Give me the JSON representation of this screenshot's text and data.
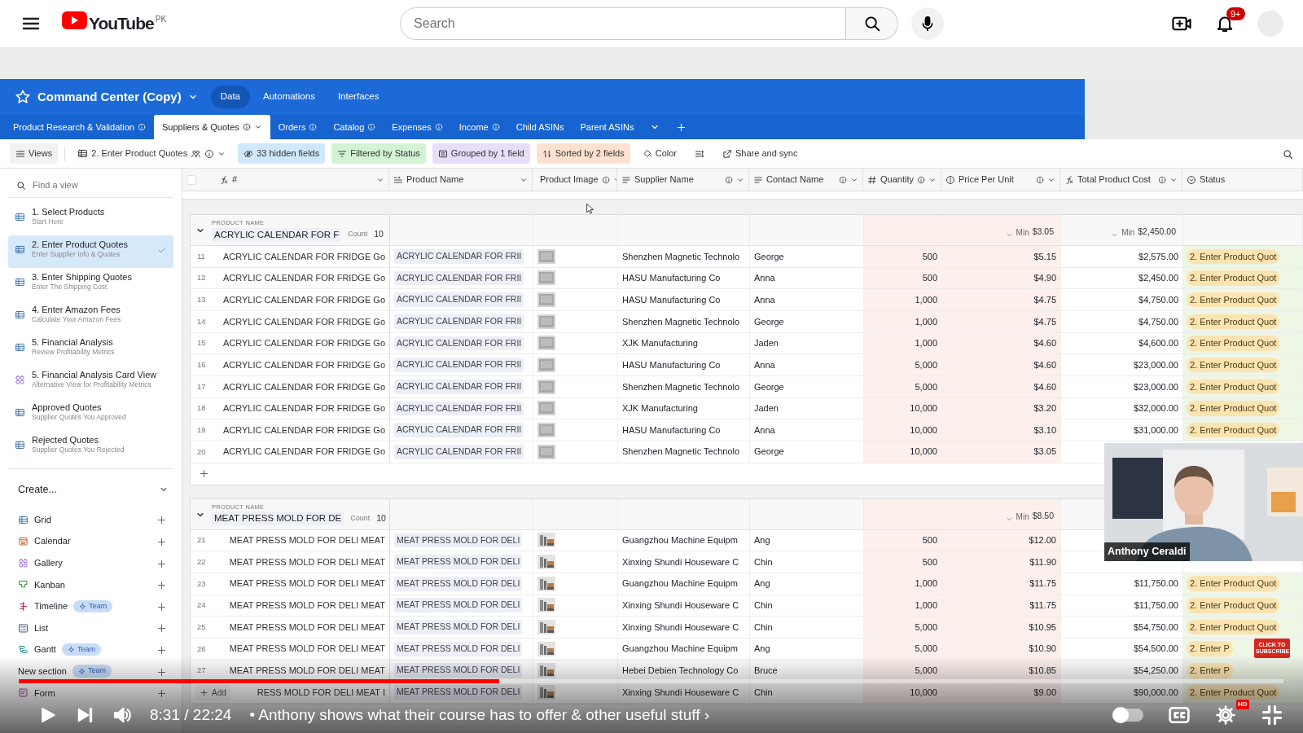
{
  "youtube": {
    "logo_text": "YouTube",
    "region": "PK",
    "search": {
      "placeholder": "Search"
    },
    "notifications": "9+"
  },
  "base": {
    "title": "Command Center (Copy)",
    "nav": [
      {
        "label": "Data",
        "selected": true
      },
      {
        "label": "Automations",
        "selected": false
      },
      {
        "label": "Interfaces",
        "selected": false
      }
    ]
  },
  "tables": [
    {
      "label": "Product Research & Validation",
      "selected": false,
      "info": true
    },
    {
      "label": "Suppliers & Quotes",
      "selected": true,
      "info": true
    },
    {
      "label": "Orders",
      "selected": false,
      "info": true
    },
    {
      "label": "Catalog",
      "selected": false,
      "info": true
    },
    {
      "label": "Expenses",
      "selected": false,
      "info": true
    },
    {
      "label": "Income",
      "selected": false,
      "info": true
    },
    {
      "label": "Child ASINs",
      "selected": false,
      "info": false
    },
    {
      "label": "Parent ASINs",
      "selected": false,
      "info": false
    }
  ],
  "toolbar": {
    "views_label": "Views",
    "view_name": "2. Enter Product Quotes",
    "items": [
      {
        "kind": "hidden",
        "label": "33 hidden fields"
      },
      {
        "kind": "filter",
        "label": "Filtered by Status"
      },
      {
        "kind": "group",
        "label": "Grouped by 1 field"
      },
      {
        "kind": "sort",
        "label": "Sorted by 2 fields"
      },
      {
        "kind": "color",
        "label": "Color"
      },
      {
        "kind": "rowheight"
      },
      {
        "kind": "share",
        "label": "Share and sync"
      }
    ]
  },
  "sidebar": {
    "search": {
      "placeholder": "Find a view"
    },
    "views": [
      {
        "kind": "grid",
        "title": "1. Select Products",
        "subtitle": "Start Here",
        "selected": false
      },
      {
        "kind": "grid",
        "title": "2. Enter Product Quotes",
        "subtitle": "Enter Supplier Info & Quotes",
        "selected": true
      },
      {
        "kind": "grid",
        "title": "3. Enter Shipping Quotes",
        "subtitle": "Enter The Shipping Cost",
        "selected": false
      },
      {
        "kind": "grid",
        "title": "4. Enter Amazon Fees",
        "subtitle": "Calculate Your Amazon Fees",
        "selected": false
      },
      {
        "kind": "grid",
        "title": "5. Financial Analysis",
        "subtitle": "Review Profitability Metrics",
        "selected": false
      },
      {
        "kind": "gallery",
        "title": "5. Financial Analysis Card View",
        "subtitle": "Alternative View for Profitability Metrics",
        "selected": false
      },
      {
        "kind": "grid",
        "title": "Approved Quotes",
        "subtitle": "Supplier Quotes You Approved",
        "selected": false
      },
      {
        "kind": "grid",
        "title": "Rejected Quotes",
        "subtitle": "Supplier Quotes You Rejected",
        "selected": false
      }
    ],
    "create_label": "Create...",
    "create": [
      {
        "kind": "grid",
        "label": "Grid"
      },
      {
        "kind": "calendar",
        "label": "Calendar"
      },
      {
        "kind": "gallery",
        "label": "Gallery"
      },
      {
        "kind": "kanban",
        "label": "Kanban"
      },
      {
        "kind": "timeline",
        "label": "Timeline",
        "badge": "Team"
      },
      {
        "kind": "list",
        "label": "List"
      },
      {
        "kind": "gantt",
        "label": "Gantt",
        "badge": "Team"
      },
      {
        "kind": "section",
        "label": "New section",
        "badge": "Team"
      },
      {
        "kind": "form",
        "label": "Form"
      }
    ]
  },
  "select_all": {
    "checked": false
  },
  "columns": [
    {
      "kind": "formula",
      "label": "#",
      "info": false
    },
    {
      "kind": "link",
      "label": "Product Name",
      "info": false
    },
    {
      "kind": "attachment",
      "label": "Product Image",
      "info": true
    },
    {
      "kind": "text",
      "label": "Supplier Name",
      "info": true
    },
    {
      "kind": "text",
      "label": "Contact Name",
      "info": true
    },
    {
      "kind": "number",
      "label": "Quantity",
      "info": true
    },
    {
      "kind": "currency",
      "label": "Price Per Unit",
      "info": true
    },
    {
      "kind": "formula",
      "label": "Total Product Cost",
      "info": true
    },
    {
      "kind": "status",
      "label": "Status",
      "info": false
    }
  ],
  "groups": [
    {
      "field_label": "PRODUCT NAME",
      "name": "ACRYLIC CALENDAR FOR F",
      "count_label": "Count",
      "count": "10",
      "expanded": true,
      "add_row": true,
      "summary": {
        "price": {
          "label": "Min",
          "value": "$3.05"
        },
        "total": {
          "label": "Min",
          "value": "$2,450.00"
        }
      },
      "rows": [
        {
          "num": "11",
          "primary": "ACRYLIC CALENDAR FOR FRIDGE Go",
          "product": "ACRYLIC CALENDAR FOR FRII",
          "supplier": "Shenzhen Magnetic Technolo",
          "contact": "George",
          "quantity": "500",
          "price": "$5.15",
          "total": "$2,575.00",
          "status": "2. Enter Product Quot"
        },
        {
          "num": "12",
          "primary": "ACRYLIC CALENDAR FOR FRIDGE Go",
          "product": "ACRYLIC CALENDAR FOR FRII",
          "supplier": "HASU Manufacturing Co",
          "contact": "Anna",
          "quantity": "500",
          "price": "$4.90",
          "total": "$2,450.00",
          "status": "2. Enter Product Quot"
        },
        {
          "num": "13",
          "primary": "ACRYLIC CALENDAR FOR FRIDGE Go",
          "product": "ACRYLIC CALENDAR FOR FRII",
          "supplier": "HASU Manufacturing Co",
          "contact": "Anna",
          "quantity": "1,000",
          "price": "$4.75",
          "total": "$4,750.00",
          "status": "2. Enter Product Quot"
        },
        {
          "num": "14",
          "primary": "ACRYLIC CALENDAR FOR FRIDGE Go",
          "product": "ACRYLIC CALENDAR FOR FRII",
          "supplier": "Shenzhen Magnetic Technolo",
          "contact": "George",
          "quantity": "1,000",
          "price": "$4.75",
          "total": "$4,750.00",
          "status": "2. Enter Product Quot"
        },
        {
          "num": "15",
          "primary": "ACRYLIC CALENDAR FOR FRIDGE Go",
          "product": "ACRYLIC CALENDAR FOR FRII",
          "supplier": "XJK Manufacturing",
          "contact": "Jaden",
          "quantity": "1,000",
          "price": "$4.60",
          "total": "$4,600.00",
          "status": "2. Enter Product Quot"
        },
        {
          "num": "16",
          "primary": "ACRYLIC CALENDAR FOR FRIDGE Go",
          "product": "ACRYLIC CALENDAR FOR FRII",
          "supplier": "HASU Manufacturing Co",
          "contact": "Anna",
          "quantity": "5,000",
          "price": "$4.60",
          "total": "$23,000.00",
          "status": "2. Enter Product Quot"
        },
        {
          "num": "17",
          "primary": "ACRYLIC CALENDAR FOR FRIDGE Go",
          "product": "ACRYLIC CALENDAR FOR FRII",
          "supplier": "Shenzhen Magnetic Technolo",
          "contact": "George",
          "quantity": "5,000",
          "price": "$4.60",
          "total": "$23,000.00",
          "status": "2. Enter Product Quot"
        },
        {
          "num": "18",
          "primary": "ACRYLIC CALENDAR FOR FRIDGE Go",
          "product": "ACRYLIC CALENDAR FOR FRII",
          "supplier": "XJK Manufacturing",
          "contact": "Jaden",
          "quantity": "10,000",
          "price": "$3.20",
          "total": "$32,000.00",
          "status": "2. Enter Product Quot"
        },
        {
          "num": "19",
          "primary": "ACRYLIC CALENDAR FOR FRIDGE Go",
          "product": "ACRYLIC CALENDAR FOR FRII",
          "supplier": "HASU Manufacturing Co",
          "contact": "Anna",
          "quantity": "10,000",
          "price": "$3.10",
          "total": "$31,000.00",
          "status": "2. Enter Product Quot"
        },
        {
          "num": "20",
          "primary": "ACRYLIC CALENDAR FOR FRIDGE Go",
          "product": "ACRYLIC CALENDAR FOR FRII",
          "supplier": "Shenzhen Magnetic Technolo",
          "contact": "George",
          "quantity": "10,000",
          "price": "$3.05"
        }
      ]
    },
    {
      "field_label": "PRODUCT NAME",
      "name": "MEAT PRESS MOLD FOR DE",
      "count_label": "Count",
      "count": "10",
      "expanded": true,
      "add_row": false,
      "summary": {
        "price": {
          "label": "Min",
          "value": "$8.50"
        }
      },
      "rows": [
        {
          "num": "21",
          "primary": "MEAT PRESS MOLD FOR DELI MEAT",
          "product": "MEAT PRESS MOLD FOR DELI",
          "supplier": "Guangzhou Machine Equipm",
          "contact": "Ang",
          "quantity": "500",
          "price": "$12.00"
        },
        {
          "num": "22",
          "primary": "MEAT PRESS MOLD FOR DELI MEAT",
          "product": "MEAT PRESS MOLD FOR DELI",
          "supplier": "Xinxing Shundi Houseware C",
          "contact": "Chin",
          "quantity": "500",
          "price": "$11.90"
        },
        {
          "num": "23",
          "primary": "MEAT PRESS MOLD FOR DELI MEAT",
          "product": "MEAT PRESS MOLD FOR DELI",
          "supplier": "Guangzhou Machine Equipm",
          "contact": "Ang",
          "quantity": "1,000",
          "price": "$11.75",
          "total": "$11,750.00",
          "status": "2. Enter Product Quot"
        },
        {
          "num": "24",
          "primary": "MEAT PRESS MOLD FOR DELI MEAT",
          "product": "MEAT PRESS MOLD FOR DELI",
          "supplier": "Xinxing Shundi Houseware C",
          "contact": "Chin",
          "quantity": "1,000",
          "price": "$11.75",
          "total": "$11,750.00",
          "status": "2. Enter Product Quot"
        },
        {
          "num": "25",
          "primary": "MEAT PRESS MOLD FOR DELI MEAT",
          "product": "MEAT PRESS MOLD FOR DELI",
          "supplier": "Xinxing Shundi Houseware C",
          "contact": "Chin",
          "quantity": "5,000",
          "price": "$10.95",
          "total": "$54,750.00",
          "status": "2. Enter Product Quot"
        },
        {
          "num": "26",
          "primary": "MEAT PRESS MOLD FOR DELI MEAT",
          "product": "MEAT PRESS MOLD FOR DELI",
          "supplier": "Guangzhou Machine Equipm",
          "contact": "Ang",
          "quantity": "5,000",
          "price": "$10.90",
          "total": "$54,500.00",
          "status": "2. Enter P"
        },
        {
          "num": "27",
          "primary": "MEAT PRESS MOLD FOR DELI MEAT",
          "product": "MEAT PRESS MOLD FOR DELI",
          "supplier": "Hebei Debien Technology Co",
          "contact": "Bruce",
          "quantity": "5,000",
          "price": "$10.85",
          "total": "$54,250.00",
          "status": "2. Enter P"
        },
        {
          "primary": "RESS MOLD FOR DELI MEAT I",
          "product": "MEAT PRESS MOLD FOR DELI",
          "supplier": "Xinxing Shundi Houseware C",
          "contact": "Chin",
          "quantity": "10,000",
          "price": "$9.00",
          "total": "$90,000.00",
          "status": "2. Enter Product Quot"
        }
      ]
    }
  ],
  "add_button": "Add",
  "webcam": {
    "kind": "picture",
    "name": "Anthony Ceraldi"
  },
  "subscribe_badge": "CLICK TO SUBSCRIBE",
  "player": {
    "progress": {
      "level": 0.38
    },
    "time": "8:31 / 22:24",
    "chapter": "• Anthony shows what their course has to offer & other useful stuff ›",
    "autoplay": false,
    "quality": "HD"
  }
}
